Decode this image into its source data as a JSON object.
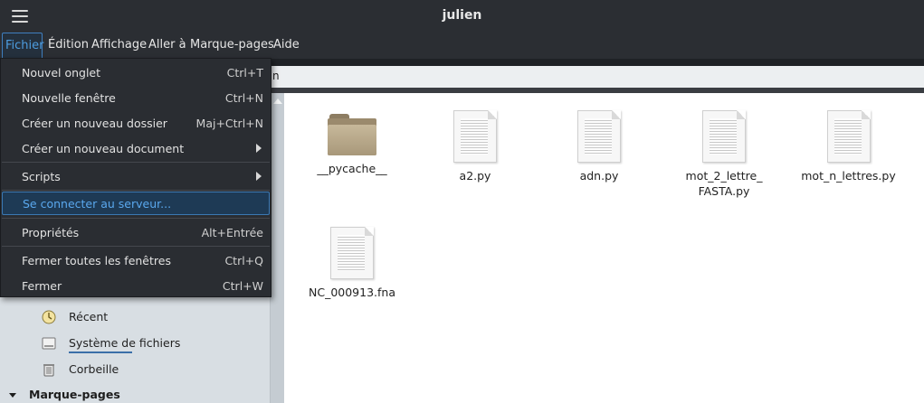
{
  "window": {
    "title": "julien"
  },
  "menubar": [
    {
      "label": "Fichier",
      "active": true
    },
    {
      "label": "Édition"
    },
    {
      "label": "Affichage"
    },
    {
      "label": "Aller à"
    },
    {
      "label": "Marque-pages"
    },
    {
      "label": "Aide"
    }
  ],
  "pathbar": {
    "text": "n"
  },
  "file_menu": {
    "new_tab": {
      "label": "Nouvel onglet",
      "shortcut": "Ctrl+T"
    },
    "new_window": {
      "label": "Nouvelle fenêtre",
      "shortcut": "Ctrl+N"
    },
    "new_folder": {
      "label": "Créer un nouveau dossier",
      "shortcut": "Maj+Ctrl+N"
    },
    "new_document": {
      "label": "Créer un nouveau document"
    },
    "scripts": {
      "label": "Scripts"
    },
    "connect_server": {
      "label": "Se connecter au serveur..."
    },
    "properties": {
      "label": "Propriétés",
      "shortcut": "Alt+Entrée"
    },
    "close_all": {
      "label": "Fermer toutes les fenêtres",
      "shortcut": "Ctrl+Q"
    },
    "close": {
      "label": "Fermer",
      "shortcut": "Ctrl+W"
    }
  },
  "sidebar": {
    "items": [
      {
        "label": "Récent",
        "icon": "recent-icon"
      },
      {
        "label": "Système de fichiers",
        "icon": "filesystem-icon"
      },
      {
        "label": "Corbeille",
        "icon": "trash-icon"
      }
    ],
    "bookmarks_section": "Marque-pages"
  },
  "files": [
    {
      "name": "__pycache__",
      "type": "folder"
    },
    {
      "name": "a2.py",
      "type": "file"
    },
    {
      "name": "adn.py",
      "type": "file"
    },
    {
      "name_line1": "mot_2_lettre_",
      "name_line2": "FASTA.py",
      "type": "file"
    },
    {
      "name": "mot_n_lettres.py",
      "type": "file"
    },
    {
      "name": "NC_000913.fna",
      "type": "file"
    }
  ]
}
